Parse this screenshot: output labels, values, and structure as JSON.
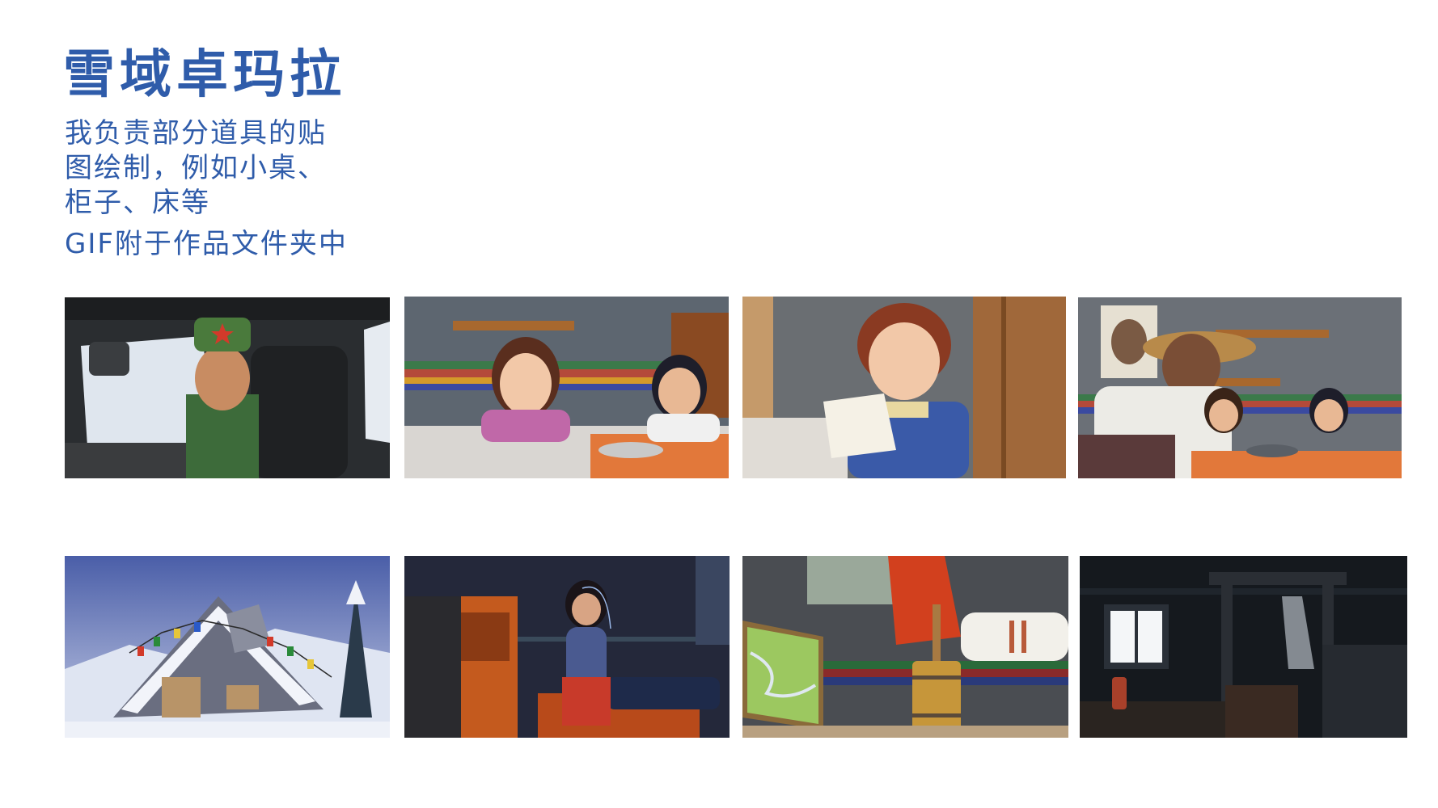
{
  "header": {
    "title": "雪域卓玛拉",
    "desc_lines": [
      "我负责部分道具的贴",
      "图绘制，例如小桌、",
      "柜子、床等"
    ],
    "gif_note": "GIF附于作品文件夹中"
  },
  "frames": [
    {
      "scene": "driver-in-truck"
    },
    {
      "scene": "two-girls-at-table"
    },
    {
      "scene": "girl-reading-letter"
    },
    {
      "scene": "grandmother-with-girls"
    },
    {
      "scene": "snowy-tent-exterior"
    },
    {
      "scene": "girl-sewing-at-night"
    },
    {
      "scene": "butter-churn-closeup"
    },
    {
      "scene": "dark-room-window"
    }
  ]
}
